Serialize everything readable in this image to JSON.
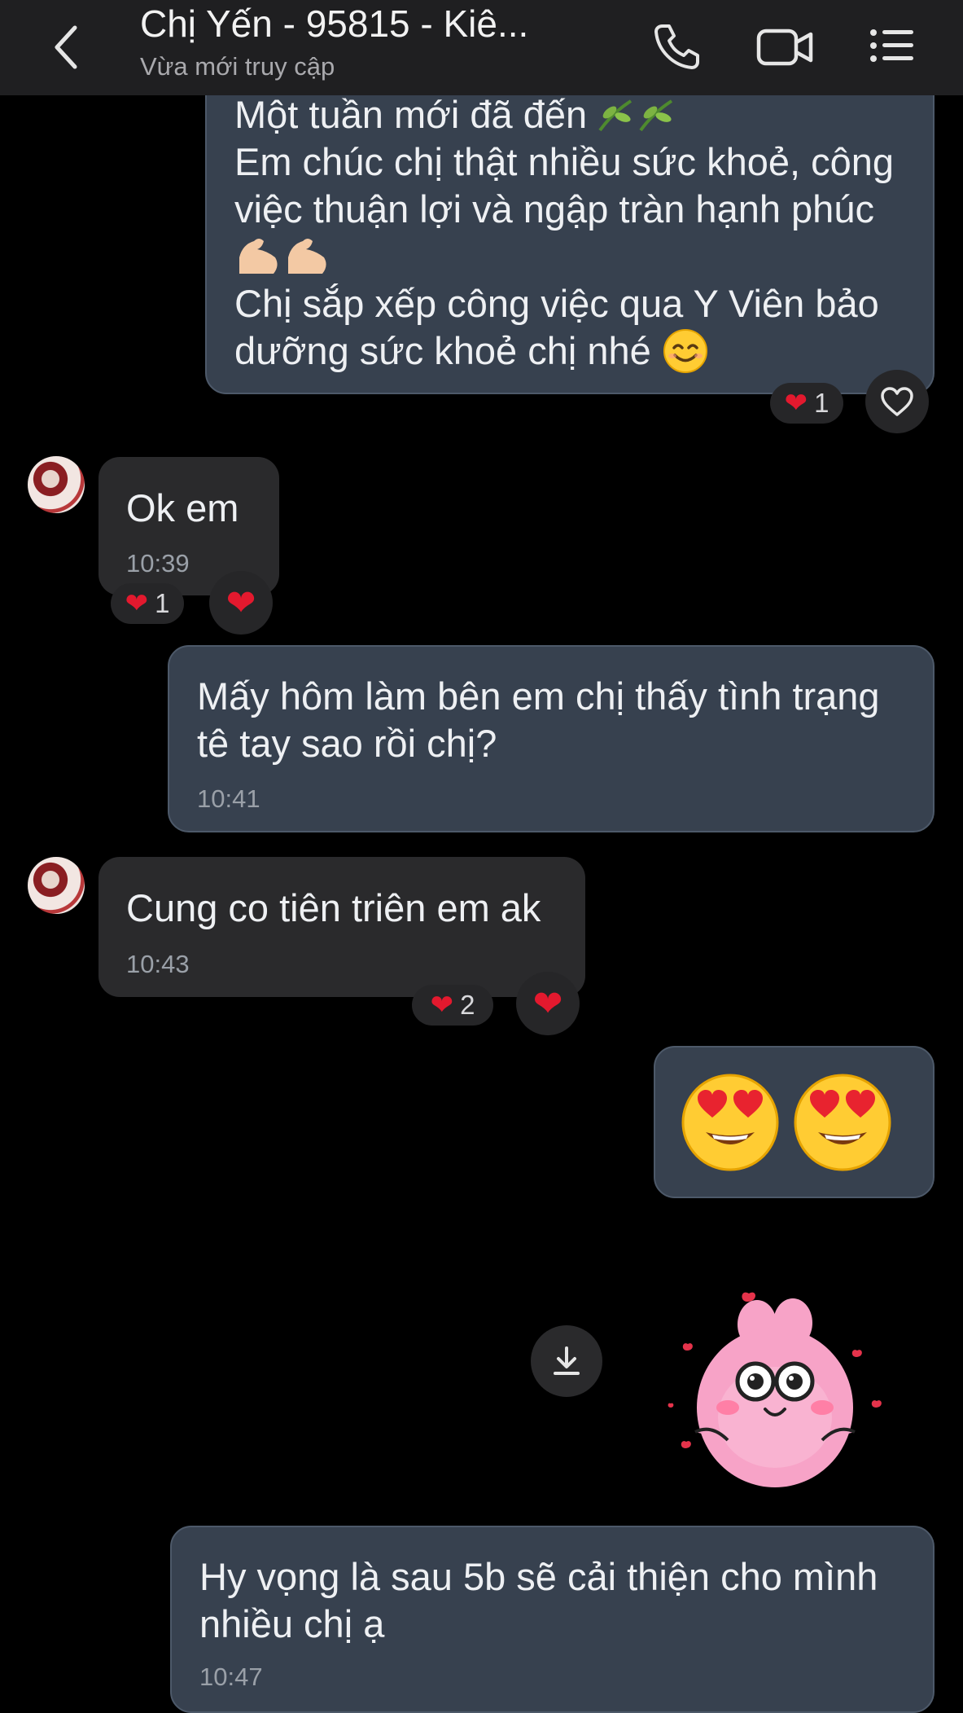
{
  "header": {
    "title": "Chị Yến - 95815 - Kiê...",
    "status": "Vừa mới truy cập"
  },
  "messages": {
    "m1": {
      "line1": "Một tuần mới đã đến",
      "line2": "Em chúc chị thật nhiều sức khoẻ, công",
      "line3": "việc thuận lợi và ngập tràn hạnh phúc",
      "line4": "Chị sắp xếp công việc qua Y Viên bảo",
      "line5": "dưỡng sức khoẻ chị nhé",
      "reaction_count": "1"
    },
    "m2": {
      "text": "Ok em",
      "time": "10:39",
      "reaction_count": "1"
    },
    "m3": {
      "text": "Mấy hôm làm bên em chị thấy tình trạng\ntê tay sao rồi chị?",
      "time": "10:41"
    },
    "m4": {
      "text": "Cung co tiên triên em ak",
      "time": "10:43",
      "reaction_count": "2"
    },
    "m7": {
      "text": "Hy vọng là sau 5b sẽ cải thiện cho mình\nnhiều chị ạ",
      "time": "10:47"
    }
  },
  "icons": {
    "back": "chevron-left-icon",
    "call": "phone-icon",
    "video": "video-camera-icon",
    "menu": "list-menu-icon",
    "download": "download-icon"
  },
  "colors": {
    "outgoing_bubble": "#37414f",
    "incoming_bubble": "#2a2a2c",
    "heart": "#e3192e"
  }
}
